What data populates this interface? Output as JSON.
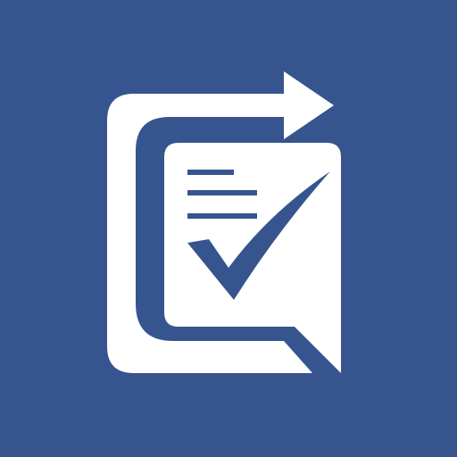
{
  "icon": {
    "name": "checklist-export-icon",
    "colors": {
      "background": "#36558F",
      "foreground": "#FFFFFF",
      "accent": "#36558F"
    }
  }
}
